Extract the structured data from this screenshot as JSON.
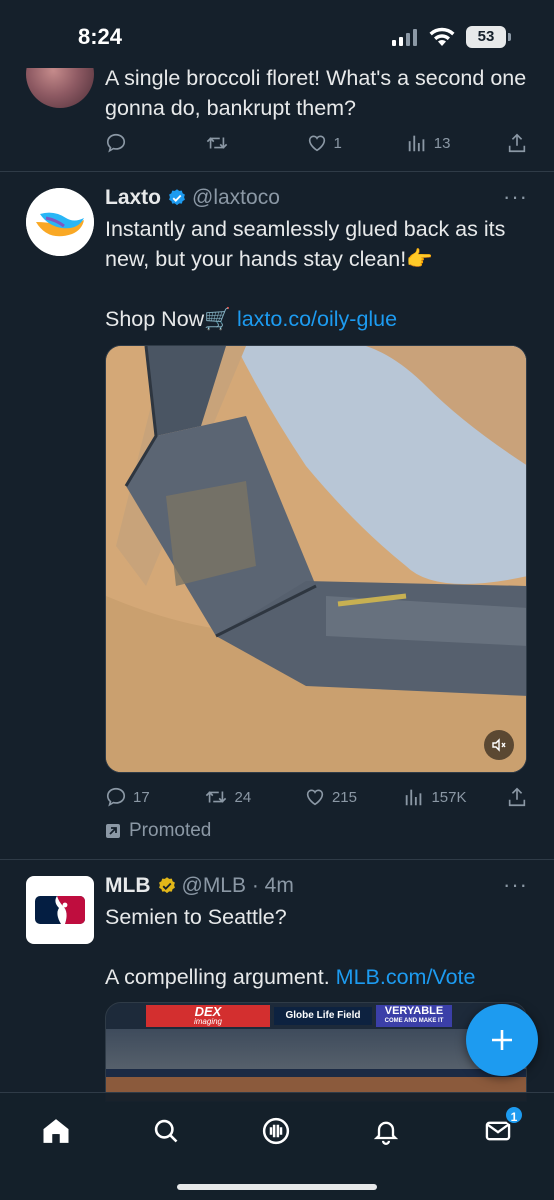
{
  "status_bar": {
    "time": "8:24",
    "battery": "53"
  },
  "tweets": [
    {
      "text": "A single broccoli floret! What's a second one gonna do, bankrupt them?",
      "reply_count": "",
      "retweet_count": "",
      "like_count": "1",
      "view_count": "13"
    },
    {
      "name": "Laxto",
      "handle": "@laxtoco",
      "text_line1": "Instantly and seamlessly glued back as its new, but your hands stay clean!👉",
      "text_line2": "Shop Now🛒 ",
      "link": "laxto.co/oily-glue",
      "reply_count": "17",
      "retweet_count": "24",
      "like_count": "215",
      "view_count": "157K",
      "promoted_label": "Promoted"
    },
    {
      "name": "MLB",
      "handle": "@MLB",
      "time": "4m",
      "text_line1": "Semien to Seattle?",
      "text_line2": "A compelling argument. ",
      "link": "MLB.com/Vote",
      "media_banners": [
        "DEX",
        "imaging",
        "Globe Life Field",
        "VERYABLE",
        "COME AND MAKE IT"
      ]
    }
  ],
  "nav": {
    "messages_badge": "1"
  },
  "colors": {
    "background": "#15202b",
    "accent": "#1d9bf0",
    "muted": "#8b98a5",
    "text": "#e7e9ea",
    "gold_check": "#e2b719"
  }
}
